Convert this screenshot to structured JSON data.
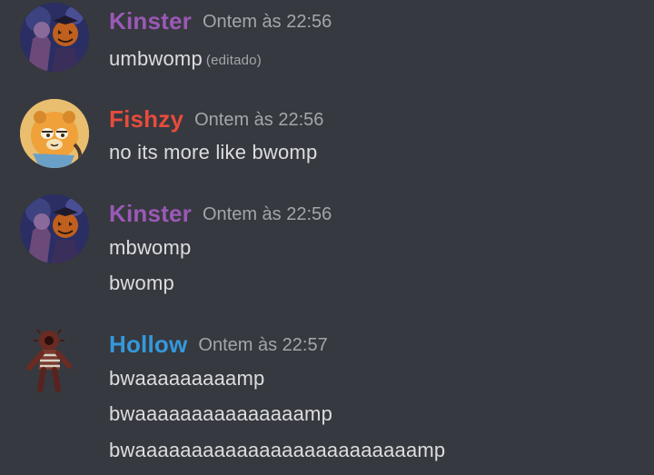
{
  "colors": {
    "background": "#36393f",
    "kinster": "#9b59b6",
    "fishzy": "#e74c3c",
    "hollow": "#3498db",
    "text": "#dcddde",
    "muted": "#a3a6aa"
  },
  "groups": [
    {
      "username": "Kinster",
      "timestamp": "Ontem às 22:56",
      "avatar_icon": "kinster-avatar",
      "messages": [
        "umbwomp"
      ],
      "edited_label": "(editado)"
    },
    {
      "username": "Fishzy",
      "timestamp": "Ontem às 22:56",
      "avatar_icon": "fishzy-avatar",
      "messages": [
        "no its more like bwomp"
      ]
    },
    {
      "username": "Kinster",
      "timestamp": "Ontem às 22:56",
      "avatar_icon": "kinster-avatar",
      "messages": [
        "mbwomp",
        "bwomp"
      ]
    },
    {
      "username": "Hollow",
      "timestamp": "Ontem às 22:57",
      "avatar_icon": "hollow-avatar",
      "messages": [
        "bwaaaaaaaaamp",
        "bwaaaaaaaaaaaaaaamp",
        "bwaaaaaaaaaaaaaaaaaaaaaaaaamp"
      ]
    }
  ]
}
